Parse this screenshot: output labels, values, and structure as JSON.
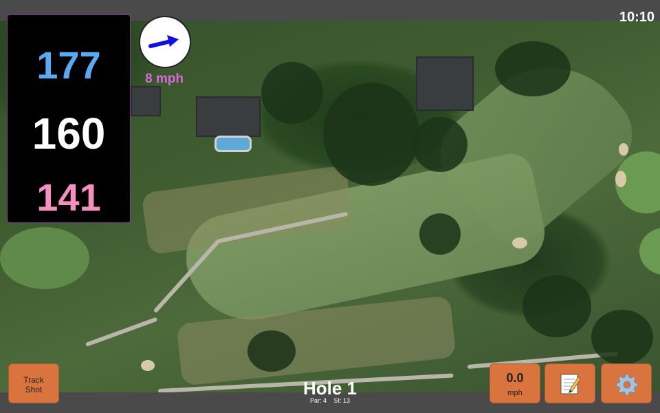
{
  "clock": "10:10",
  "yardages": {
    "back": "177",
    "center": "160",
    "front": "141"
  },
  "wind": {
    "speed": "8 mph",
    "icon": "wind-direction-arrow-icon"
  },
  "buttons": {
    "track_shot_line1": "Track",
    "track_shot_line2": "Shot",
    "speed_value": "0.0",
    "speed_unit": "mph",
    "notes_icon": "notepad-icon",
    "settings_icon": "gear-icon"
  },
  "hole": {
    "title": "Hole 1",
    "par": "Par: 4",
    "stroke_index": "SI: 13"
  },
  "colors": {
    "back_yardage": "#5ba9f2",
    "center_yardage": "#ffffff",
    "front_yardage": "#f58fc0",
    "wind_text": "#d96ad9",
    "button_bg": "#d9743f"
  }
}
